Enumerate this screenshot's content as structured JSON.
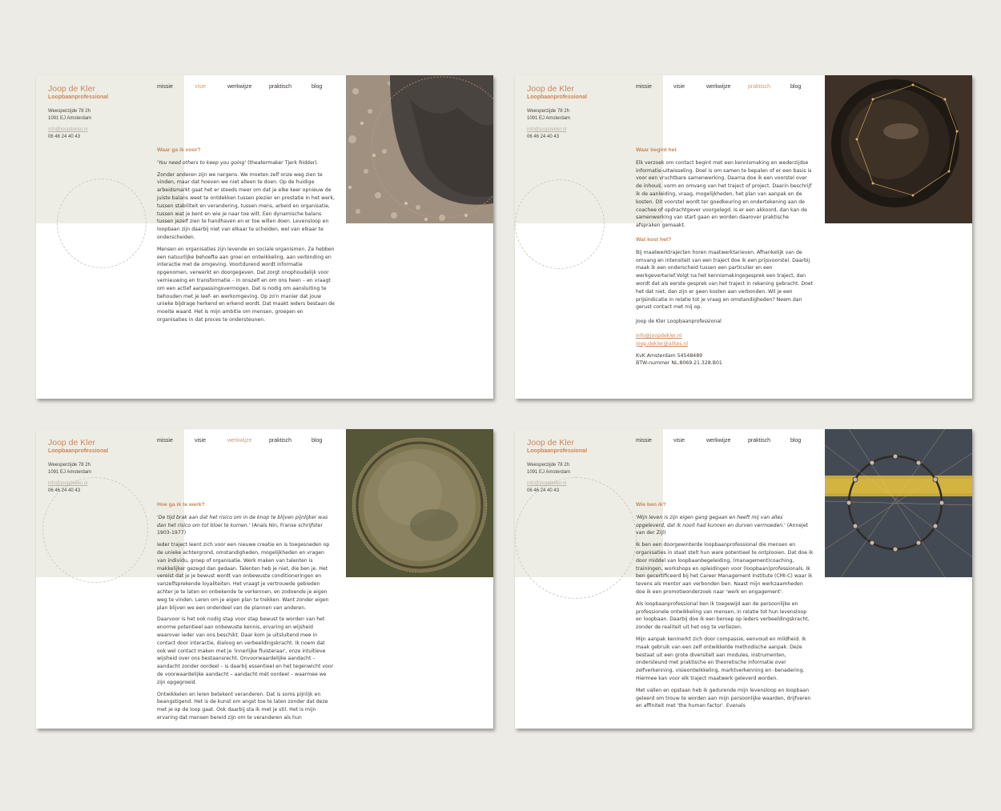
{
  "brand": {
    "name": "Joop de Kler",
    "subtitle": "Loopbaanprofessional"
  },
  "address": {
    "street": "Weesperzijde 78 2h",
    "city": "1091 EJ Amsterdam",
    "email": "info@joopdekler.nl",
    "phone": "06 46 24 40 43"
  },
  "nav": [
    "missie",
    "visie",
    "werkwijze",
    "praktisch",
    "blog"
  ],
  "colors": {
    "accent": "#c9865a",
    "band": "#eeede5",
    "background": "#ecebe6"
  },
  "pages": {
    "visie": {
      "heading": "Waar ga ik voor?",
      "quote": "'You need others to keep you going'",
      "quote_source": " (theatermaker Tjerk Ridder).",
      "p1": "Zonder anderen zijn we nergens. We moeten zelf onze weg zien te vinden, maar dat hoeven we niet alleen te doen. Op de huidige arbeidsmarkt gaat het er steeds meer om dat je elke keer opnieuw de juiste balans weet te ontdekken tussen plezier en prestatie in het werk, tussen stabiliteit en verandering, tussen mens, arbeid en organisatie, tussen wat je bent en wie je naar toe wilt. Een dynamische balans tussen jezelf zien te handhaven en er toe willen doen. Levensloop en loopbaan zijn daarbij niet van elkaar te scheiden, wel van elkaar te onderscheiden.",
      "p2": "Mensen en organisaties zijn levende en sociale organismen. Ze hebben een natuurlijke behoefte aan groei en ontwikkeling, aan verbinding en interactie met de omgeving. Voortdurend wordt informatie opgenomen, verwerkt en doorgegeven. Dat zorgt onophoudelijk voor vernieuwing en transformatie – in onszelf en om ons heen – en vraagt om een actief aanpassingsvermogen. Dat is nodig om aansluiting te behouden met je leef- en werkomgeving. Op zo'n manier dat jouw unieke bijdrage herkend en erkend wordt. Dat maakt ieders bestaan de moeite waard. Het is mijn ambitie om mensen, groepen en organisaties in dat proces te ondersteunen."
    },
    "praktisch": {
      "heading1": "Waar begint het",
      "p1": "Elk verzoek om contact begint met een kennismaking en wederzijdse informatie-uitwisseling. Doel is om samen te bepalen of er een basis is voor een vruchtbare samenwerking. Daarna doe ik een voorstel over de inhoud, vorm en omvang van het traject of project. Daarin beschrijf ik de aanleiding, vraag, mogelijkheden, het plan van aanpak en de kosten. Dit voorstel wordt ter goedkeuring en ondertekening aan de coachee of opdrachtgever voorgelegd. Is er een akkoord, dan kan de samenwerking van start gaan en worden daarover praktische afspraken gemaakt.",
      "heading2": "Wat kost het?",
      "p2": "Bij maatwerktrajecten horen maatwerktarieven. Afhankelijk van de omvang en intensiteit van een traject doe ik een prijsvoorstel. Daarbij maak ik een onderscheid tussen een particulier en een werkgevertarief.Volgt na het kennismakingsgesprek een traject, dan wordt dat als eerste gesprek van het traject in rekening gebracht. Doet het dat niet, dan zijn er geen kosten aan verbonden. Wil je een prijsindicatie in relatie tot je vraag en omstandigheden? Neem dan gerust contact met mij op.",
      "signature": "Joop de Kler Loopbaanprofessional",
      "link1": "info@joopdekler.nl",
      "link2": "joop.dekler@alites.nl",
      "kvk": "KvK Amsterdam 54548489",
      "btw": "BTW-nummer NL.8069.21.328.B01"
    },
    "werkwijze": {
      "heading": "Hoe ga ik te werk?",
      "quote": "'De tijd brak aan dat het risico om in de knop te blijven pijnlijker was dan het risico om tot bloei te komen.'",
      "quote_source": " (Anaïs Nin, Franse schrijfster 1903-1977)",
      "p1": "Ieder traject leent zich voor een nieuwe creatie en is toegesneden op de unieke achtergrond, omstandigheden, mogelijkheden en vragen van individu, groep of organisatie. Werk maken van talenten is makkelijker gezegd dan gedaan. Talenten heb je niet, die ben je. Het vereist dat je je bewust wordt van onbewuste conditioneringen en vanzelfsprekende loyaliteiten. Het vraagt je vertrouwde gebieden achter je te laten en onbekende te verkennen, en zodoende je eigen weg te vinden. Leren om je eigen plan te trekken. Want zonder eigen plan blijven we een onderdeel van de plannen van anderen.",
      "p2": "Daarvoor is het ook nodig stap voor stap bewust te worden van het enorme potentieel aan onbewuste kennis, ervaring en wijsheid waarover ieder van ons beschikt. Daar kom je uitsluitend mee in contact door interactie, dialoog en verbeeldingskracht. Ik noem dat ook wel contact maken met je 'innerlijke fluisteraar', onze intuïtieve wijsheid over ons bestaansrecht. Onvoorwaardelijke aandacht – aandacht zonder oordeel – is daarbij essentieel en het tegenwicht voor de voorwaardelijke aandacht – aandacht mét oordeel – waarmee we zijn opgegroeid.",
      "p3": "Ontwikkelen en leren betekent veranderen. Dat is soms pijnlijk en beangstigend. Het is de kunst om angst toe te laten zonder dat deze met je op de loop gaat. Ook daarbij sta ik met je stil. Het is mijn ervaring dat mensen bereid zijn om te veranderen als hun"
    },
    "missie": {
      "heading": "Wie ben ik?",
      "quote": "'Mijn leven is zijn eigen gang gegaan en heeft mij van alles opgeleverd, dat ik nooit had kunnen en durven vermoeden.'",
      "quote_source": " (Annejet van der Zijl)",
      "p1": "Ik ben een doorgewinterde loopbaanprofessional die mensen en organisaties in staat stelt hun ware potentieel te ontplooien. Dat doe ik door middel van loopbaanbegeleiding, (management)coaching, trainingen, workshops en opleidingen voor (loopbaan)professionals. Ik ben gecertificeerd bij het Career Management Institute (CMI-C) waar ik tevens als mentor aan verbonden ben. Naast mijn werkzaamheden doe ik een promotieonderzoek naar 'werk en engagement'.",
      "p2": "Als loopbaanprofessional ben ik toegewijd aan de persoonlijke en professionele ontwikkeling van mensen, in relatie tot hun levensloop en loopbaan. Daarbij doe ik een beroep op ieders verbeeldingskracht, zonder de realiteit uit het oog te verliezen.",
      "p3": "Mijn aanpak kenmerkt zich door compassie, eenvoud en mildheid. Ik maak gebruik van een zelf ontwikkelde  methodische aanpak. Deze bestaat uit een grote diversiteit aan modules, instrumenten, ondersteund met praktische en theoretische informatie over zelfverkenning, visieontwikkeling, marktverkenning en -benadering. Hiermee kan voor elk traject maatwerk geleverd worden.",
      "p4": "Met vallen en opstaan heb ik gedurende mijn levensloop en loopbaan geleerd om trouw te worden aan mijn persoonlijke waarden, drijfveren en affiniteit met 'the human factor'. Evenals"
    }
  }
}
